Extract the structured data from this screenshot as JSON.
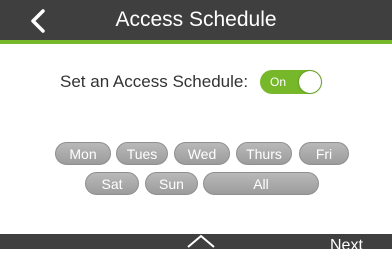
{
  "header": {
    "title": "Access Schedule",
    "back_icon": "chevron-left-icon"
  },
  "schedule": {
    "label": "Set an Access Schedule:",
    "toggle_state": "On",
    "accent_color": "#76b82a"
  },
  "days": {
    "mon": "Mon",
    "tues": "Tues",
    "wed": "Wed",
    "thurs": "Thurs",
    "fri": "Fri",
    "sat": "Sat",
    "sun": "Sun",
    "all": "All"
  },
  "footer": {
    "home_icon": "home-icon",
    "next_label": "Next"
  }
}
